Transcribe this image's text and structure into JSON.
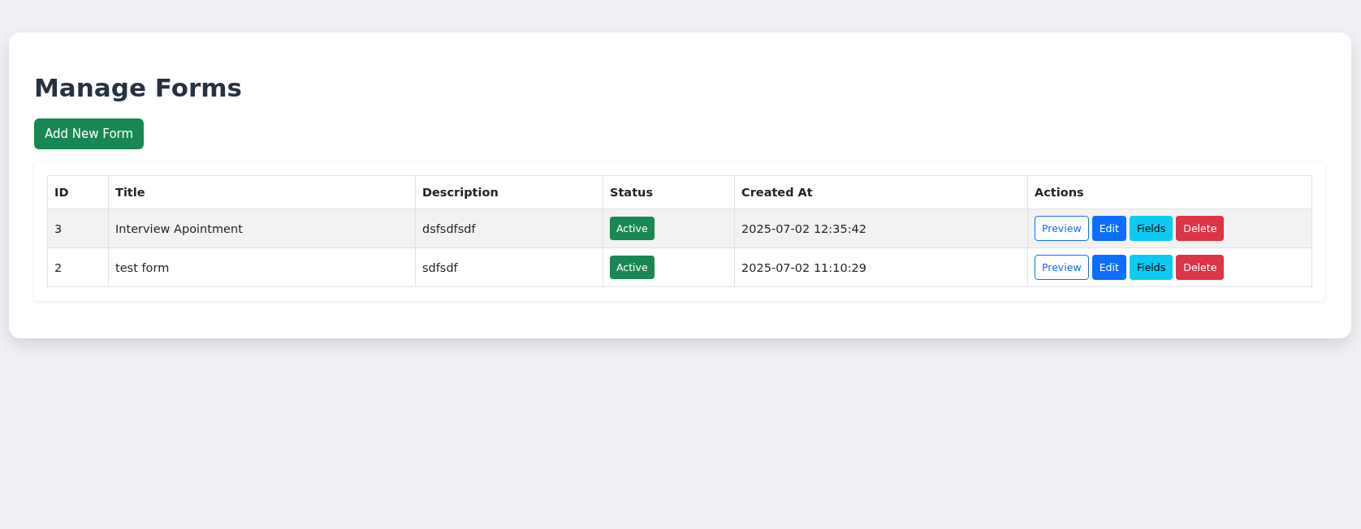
{
  "title": "Manage Forms",
  "add_button": "Add New Form",
  "table": {
    "columns": [
      "ID",
      "Title",
      "Description",
      "Status",
      "Created At",
      "Actions"
    ],
    "rows": [
      {
        "id": "3",
        "title": "Interview Apointment",
        "description": "dsfsdfsdf",
        "status": "Active",
        "created_at": "2025-07-02 12:35:42",
        "actions": [
          {
            "label": "Preview",
            "kind": "outline"
          },
          {
            "label": "Edit",
            "kind": "primary"
          },
          {
            "label": "Fields",
            "kind": "info"
          },
          {
            "label": "Delete",
            "kind": "danger"
          }
        ]
      },
      {
        "id": "2",
        "title": "test form",
        "description": "sdfsdf",
        "status": "Active",
        "created_at": "2025-07-02 11:10:29",
        "actions": [
          {
            "label": "Preview",
            "kind": "outline"
          },
          {
            "label": "Edit",
            "kind": "primary"
          },
          {
            "label": "Fields",
            "kind": "info"
          },
          {
            "label": "Delete",
            "kind": "danger"
          }
        ]
      }
    ]
  }
}
